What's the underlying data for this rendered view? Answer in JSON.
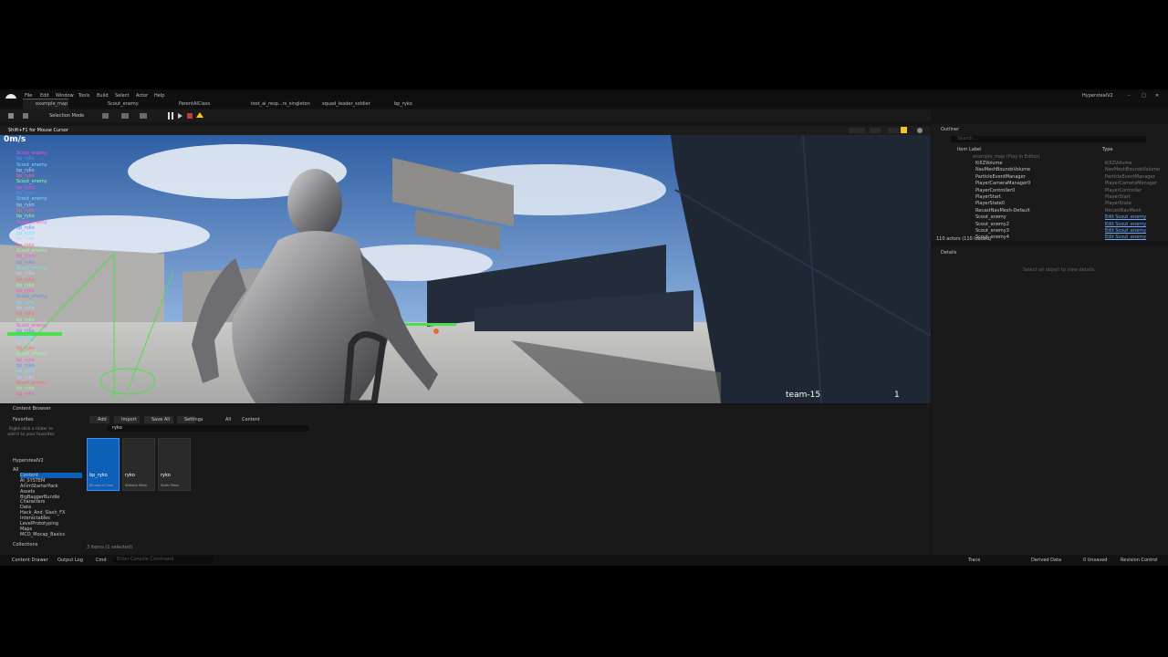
{
  "window": {
    "title": "HyperstealV2"
  },
  "menu": [
    "File",
    "Edit",
    "Window",
    "Tools",
    "Build",
    "Select",
    "Actor",
    "Help"
  ],
  "tabs": [
    {
      "label": "example_map",
      "active": true
    },
    {
      "label": "Scout_enemy"
    },
    {
      "label": "ParentAIClass"
    },
    {
      "label": "test_ai_resp...rs_singleton"
    },
    {
      "label": "squad_leader_soldier"
    },
    {
      "label": "bp_ryko"
    }
  ],
  "toolbar": {
    "mode": "Selection Mode"
  },
  "viewport": {
    "overlay": "Shift+F1 for Mouse Cursor",
    "speed": "0m/s",
    "hud_team": "team-15",
    "hud_count": "1",
    "debug_lines": [
      "Scout_enemy",
      "bp_ryko",
      "Scout_enemy",
      "bp_ryko",
      "bp_ryko",
      "Scout_enemy",
      "bp_ryko",
      "bp_ryko",
      "Scout_enemy",
      "bp_ryko",
      "bp_ryko",
      "bp_ryko",
      "Scout_enemy",
      "bp_ryko",
      "bp_ryko",
      "bp_ryko",
      "bp_ryko",
      "Scout_enemy",
      "bp_ryko",
      "bp_ryko",
      "Scout_enemy",
      "bp_ryko",
      "bp_ryko",
      "bp_ryko",
      "bp_ryko",
      "Scout_enemy",
      "bp_ryko",
      "bp_ryko",
      "bp_ryko",
      "bp_ryko",
      "Scout_enemy",
      "bp_ryko",
      "bp_ryko",
      "bp_ryko",
      "bp_ryko",
      "Scout_enemy",
      "bp_ryko",
      "bp_ryko",
      "bp_ryko",
      "bp_ryko",
      "Scout_enemy",
      "bp_ryko",
      "bp_ryko"
    ]
  },
  "outliner": {
    "title": "Outliner",
    "search_placeholder": "Search...",
    "col_label": "Item Label",
    "col_type": "Type",
    "map_row": "example_map (Play In Editor)",
    "rows": [
      {
        "label": "KillZVolume",
        "type": "KillZVolume"
      },
      {
        "label": "NavMeshBoundsVolume",
        "type": "NavMeshBoundsVolume"
      },
      {
        "label": "ParticleEventManager",
        "type": "ParticleEventManager"
      },
      {
        "label": "PlayerCameraManager0",
        "type": "PlayerCameraManager"
      },
      {
        "label": "PlayerController0",
        "type": "PlayerController"
      },
      {
        "label": "PlayerStart",
        "type": "PlayerStart"
      },
      {
        "label": "PlayerState0",
        "type": "PlayerState"
      },
      {
        "label": "RecastNavMesh-Default",
        "type": "RecastNavMesh"
      },
      {
        "label": "Scout_enemy",
        "type": "Edit Scout_enemy"
      },
      {
        "label": "Scout_enemy2",
        "type": "Edit Scout_enemy"
      },
      {
        "label": "Scout_enemy3",
        "type": "Edit Scout_enemy"
      },
      {
        "label": "Scout_enemy4",
        "type": "Edit Scout_enemy"
      }
    ],
    "footer": "110 actors (110 loaded)"
  },
  "details": {
    "title": "Details",
    "empty": "Select an object to view details."
  },
  "content_browser": {
    "title": "Content Browser",
    "add": "Add",
    "import": "Import",
    "save_all": "Save All",
    "settings": "Settings",
    "path": [
      "All",
      "Content"
    ],
    "search_value": "ryko",
    "favorites_label": "Favorites",
    "favorites_hint": "Right-click a folder to add it to your favorites",
    "project_label": "HyperstealV2",
    "tree": [
      "All",
      "Content",
      "AI_SYSTEM",
      "AnimStarterPack",
      "Assets",
      "BigBaggerBundle",
      "Characters",
      "Data",
      "Hack_And_Slash_FX",
      "Interactables",
      "LevelPrototyping",
      "Maps",
      "MCO_Mocap_Basics"
    ],
    "collections_label": "Collections",
    "assets": [
      {
        "name": "bp_ryko",
        "sub": "Blueprint Class",
        "selected": true
      },
      {
        "name": "ryko",
        "sub": "Skeletal Mesh"
      },
      {
        "name": "ryko",
        "sub": "Static Mesh"
      }
    ],
    "count": "3 items (1 selected)"
  },
  "statusbar": {
    "content_drawer": "Content Drawer",
    "output_log": "Output Log",
    "cmd": "Cmd",
    "cmd_placeholder": "Enter Console Command",
    "trace": "Trace",
    "derived": "Derived Data",
    "source": "0 Unsaved",
    "revision": "Revision Control"
  },
  "colors": {
    "selection": "#0e5fb8",
    "accent": "#f5c518",
    "play_red": "#c43c3c"
  }
}
